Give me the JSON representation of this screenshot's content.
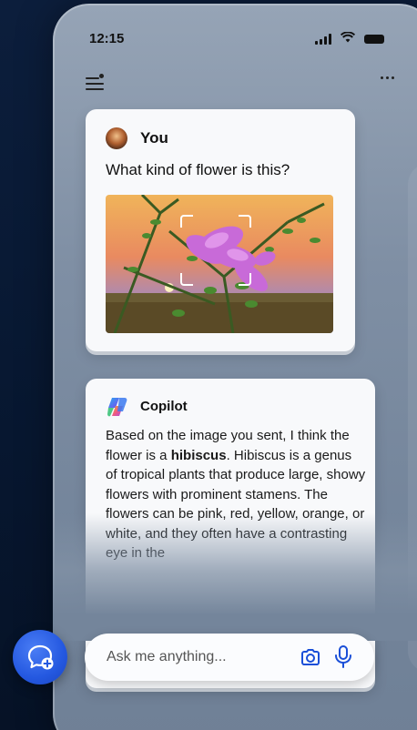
{
  "status_bar": {
    "time": "12:15",
    "icons": [
      "signal-icon",
      "wifi-icon",
      "battery-icon"
    ]
  },
  "header": {
    "menu_icon": "menu-icon",
    "more_icon": "more-icon"
  },
  "user_message": {
    "sender": "You",
    "text": "What kind of flower is this?",
    "image": "flower-photo"
  },
  "copilot_message": {
    "sender": "Copilot",
    "text_before": "Based on the image you sent, I think the flower is a ",
    "highlight": "hibiscus",
    "text_after": ". Hibiscus is a genus of tropical plants that produce large, showy flowers with prominent stamens. The flowers can be pink, red, yellow, orange, or white, and they often have a contrasting eye in the"
  },
  "composer": {
    "placeholder": "Ask me anything...",
    "new_chat_icon": "new-chat-icon",
    "camera_icon": "camera-icon",
    "mic_icon": "microphone-icon"
  },
  "colors": {
    "accent": "#2458e0",
    "icon_blue": "#1a4fd8",
    "card_bg": "#f8f9fb"
  }
}
